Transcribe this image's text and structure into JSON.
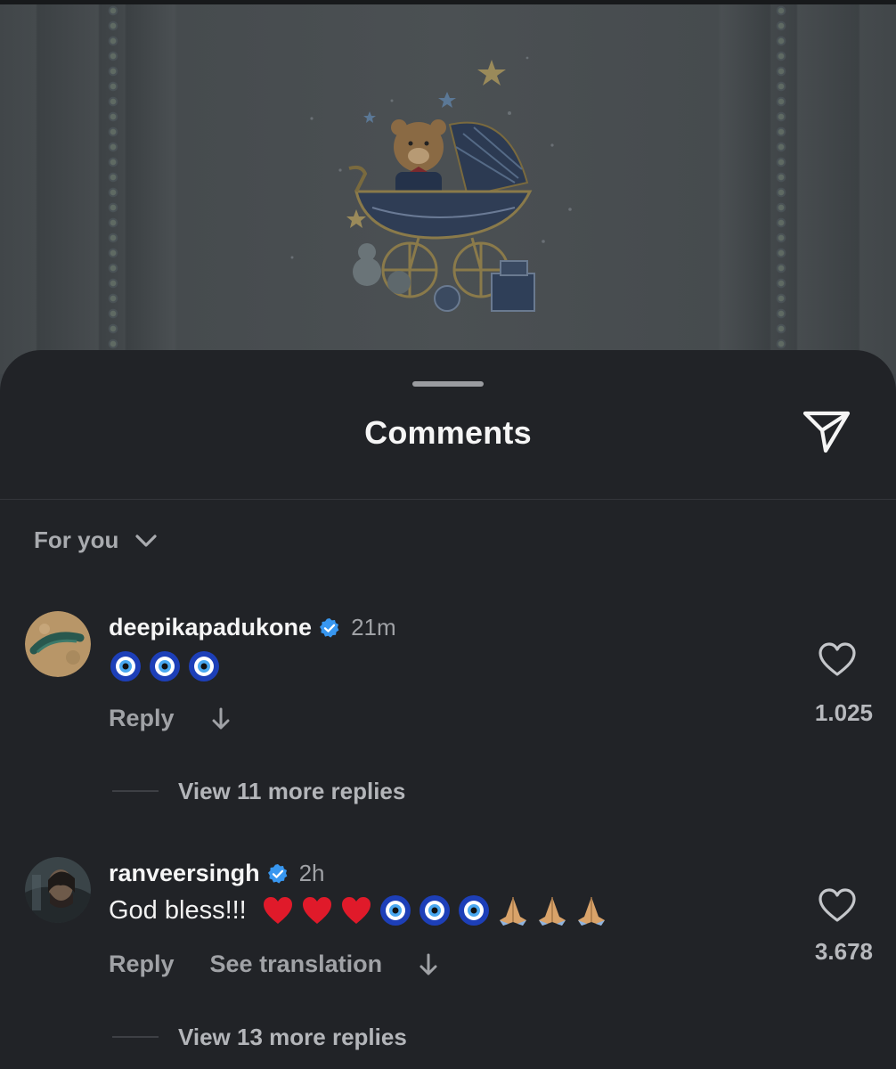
{
  "post": {
    "image_description_icon": "baby-pram-teddy-bear-illustration"
  },
  "sheet": {
    "title": "Comments",
    "share_icon": "send-paper-plane-icon",
    "filter_label": "For you"
  },
  "comments": [
    {
      "username": "deepikapadukone",
      "verified": true,
      "time": "21m",
      "text": "",
      "emojis": [
        "nazar-amulet",
        "nazar-amulet",
        "nazar-amulet"
      ],
      "reply_label": "Reply",
      "likes": "1.025",
      "view_replies": "View 11 more replies"
    },
    {
      "username": "ranveersingh",
      "verified": true,
      "time": "2h",
      "text": "God bless!!!",
      "emojis": [
        "red-heart",
        "red-heart",
        "red-heart",
        "nazar-amulet",
        "nazar-amulet",
        "nazar-amulet",
        "folded-hands",
        "folded-hands",
        "folded-hands"
      ],
      "reply_label": "Reply",
      "translate_label": "See translation",
      "likes": "3.678",
      "view_replies": "View 13 more replies"
    }
  ],
  "colors": {
    "sheet_bg": "#212327",
    "verified_blue": "#3897f0",
    "text_primary": "#f5f5f5",
    "text_secondary": "#a0a2a6"
  }
}
